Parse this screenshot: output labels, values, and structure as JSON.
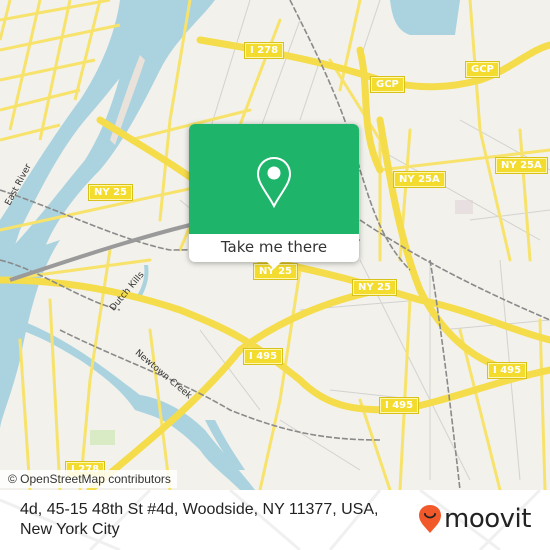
{
  "map": {
    "attribution": "© OpenStreetMap contributors",
    "colors": {
      "land": "#f2f1ec",
      "water": "#aad3df",
      "road": "#f7e36b",
      "road_casing": "#e3c95a",
      "minor": "#cfcfcf",
      "rail": "#8a8a8a",
      "park": "#d8ebc5"
    },
    "shields": [
      {
        "id": "i278-top",
        "label": "I 278"
      },
      {
        "id": "gcp-1",
        "label": "GCP"
      },
      {
        "id": "gcp-2",
        "label": "GCP"
      },
      {
        "id": "ny25-west",
        "label": "NY 25"
      },
      {
        "id": "ny25a-1",
        "label": "NY 25A"
      },
      {
        "id": "ny25a-2",
        "label": "NY 25A"
      },
      {
        "id": "ny25-center",
        "label": "NY 25"
      },
      {
        "id": "ny25-east",
        "label": "NY 25"
      },
      {
        "id": "i495-1",
        "label": "I 495"
      },
      {
        "id": "i495-2",
        "label": "I 495"
      },
      {
        "id": "i495-3",
        "label": "I 495"
      },
      {
        "id": "i278-bottom",
        "label": "I 278"
      }
    ],
    "water_labels": [
      {
        "id": "east-river",
        "label": "East River"
      },
      {
        "id": "dutch-kills",
        "label": "Dutch Kills"
      },
      {
        "id": "newtown-creek",
        "label": "Newtown Creek"
      }
    ]
  },
  "popup": {
    "icon": "location-pin-icon",
    "button_label": "Take me there",
    "color": "#1eb56b"
  },
  "footer": {
    "address": "4d, 45-15 48th St #4d, Woodside, NY 11377, USA, New York City",
    "brand": "moovit",
    "brand_color": "#f1592a"
  }
}
